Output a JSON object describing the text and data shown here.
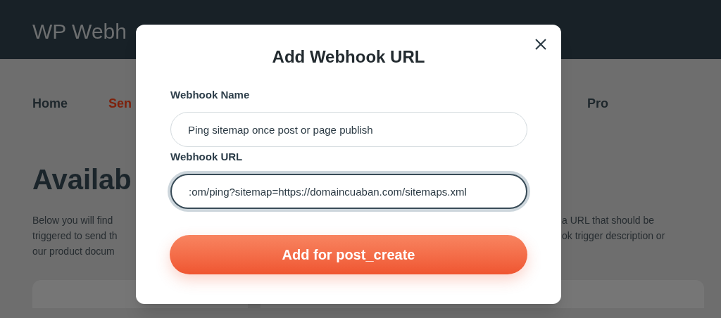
{
  "header": {
    "title": "WP Webh"
  },
  "nav": [
    {
      "label": "Home",
      "selected": false
    },
    {
      "label": "Sen",
      "selected": true
    },
    {
      "label": "Pro",
      "selected": false
    }
  ],
  "heading": "Availab",
  "intro_left": [
    "Below you will find",
    "triggered to send th",
    "our product docum"
  ],
  "intro_right": [
    "a URL that should be",
    "ok trigger description or"
  ],
  "modal": {
    "title": "Add Webhook URL",
    "fields": [
      {
        "label": "Webhook Name",
        "value": "Ping sitemap once post or page publish",
        "focused": false
      },
      {
        "label": "Webhook URL",
        "value": ":om/ping?sitemap=https://domaincuaban.com/sitemaps.xml",
        "focused": true
      }
    ],
    "button": "Add for post_create"
  }
}
